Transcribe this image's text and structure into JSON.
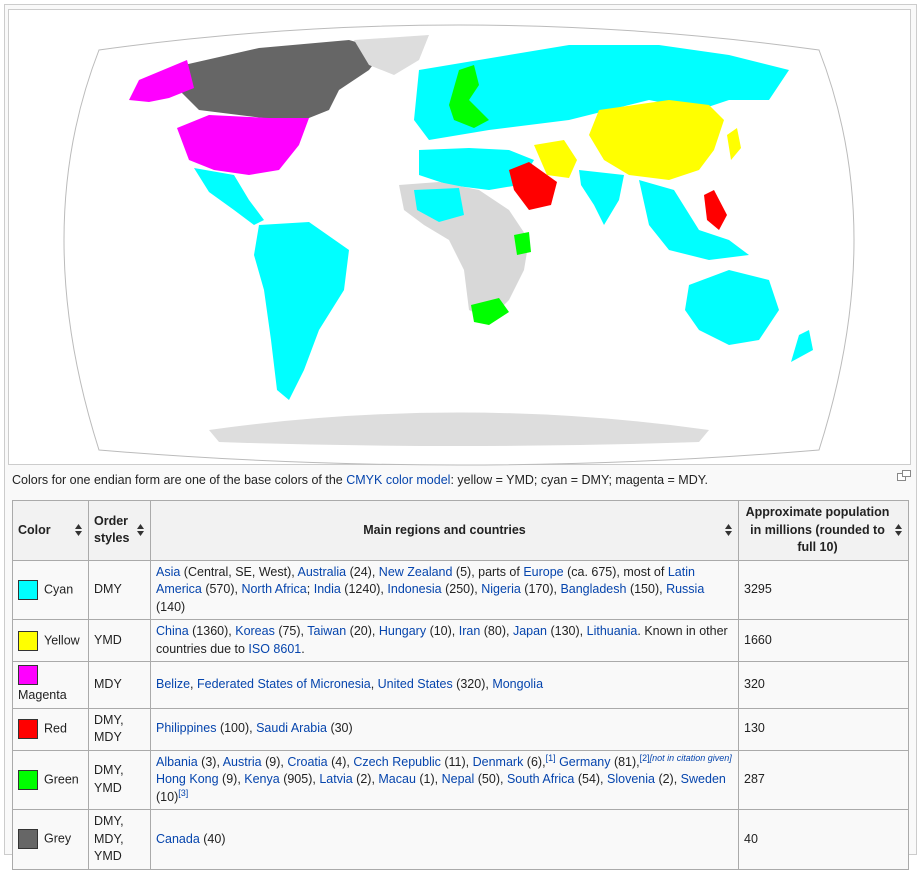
{
  "caption": {
    "before": "Colors for one endian form are one of the base colors of the ",
    "link": "CMYK color model",
    "after": ": yellow = YMD; cyan = DMY; magenta = MDY."
  },
  "map": {
    "colors": {
      "cyan": "#00ffff",
      "yellow": "#ffff00",
      "magenta": "#ff00ff",
      "red": "#ff0000",
      "green": "#00ff00",
      "grey": "#666666",
      "land_unknown": "#d8d8d8",
      "land_light": "#e0e0e0"
    }
  },
  "table": {
    "headers": {
      "color": "Color",
      "order_styles": "Order styles",
      "regions": "Main regions and countries",
      "population": "Approximate population in millions (rounded to full 10)"
    },
    "rows": [
      {
        "swatch": "#00ffff",
        "color": "Cyan",
        "order": "DMY",
        "population": "3295"
      },
      {
        "swatch": "#ffff00",
        "color": "Yellow",
        "order": "YMD",
        "population": "1660"
      },
      {
        "swatch": "#ff00ff",
        "color": "Magenta",
        "order": "MDY",
        "population": "320"
      },
      {
        "swatch": "#ff0000",
        "color": "Red",
        "order": "DMY, MDY",
        "population": "130"
      },
      {
        "swatch": "#00ff00",
        "color": "Green",
        "order": "DMY, YMD",
        "population": "287"
      },
      {
        "swatch": "#666666",
        "color": "Grey",
        "order": "DMY, MDY, YMD",
        "population": "40"
      }
    ],
    "regions": {
      "cyan": {
        "asia": "Asia",
        "asia_note": " (Central, SE, West), ",
        "australia": "Australia",
        "australia_n": " (24), ",
        "nz": "New Zealand",
        "nz_n": " (5), parts of ",
        "europe": "Europe",
        "europe_n": " (ca. 675), most of ",
        "latam": "Latin America",
        "latam_n": " (570), ",
        "nafrica": "North Africa",
        "nafrica_n": "; ",
        "india": "India",
        "india_n": " (1240), ",
        "indonesia": "Indonesia",
        "indonesia_n": " (250), ",
        "nigeria": "Nigeria",
        "nigeria_n": " (170), ",
        "bangladesh": "Bangladesh",
        "bangladesh_n": " (150), ",
        "russia": "Russia",
        "russia_n": " (140)"
      },
      "yellow": {
        "china": "China",
        "china_n": " (1360), ",
        "koreas": "Koreas",
        "koreas_n": " (75), ",
        "taiwan": "Taiwan",
        "taiwan_n": " (20), ",
        "hungary": "Hungary",
        "hungary_n": " (10), ",
        "iran": "Iran",
        "iran_n": " (80), ",
        "japan": "Japan",
        "japan_n": " (130), ",
        "lithuania": "Lithuania",
        "lithuania_n": ". Known in other countries due to ",
        "iso": "ISO 8601",
        "iso_n": "."
      },
      "magenta": {
        "belize": "Belize",
        "sep1": ", ",
        "micronesia": "Federated States of Micronesia",
        "sep2": ", ",
        "usa": "United States",
        "usa_n": " (320), ",
        "mongolia": "Mongolia"
      },
      "red": {
        "philippines": "Philippines",
        "philippines_n": " (100), ",
        "saudi": "Saudi Arabia",
        "saudi_n": " (30)"
      },
      "green": {
        "albania": "Albania",
        "albania_n": " (3), ",
        "austria": "Austria",
        "austria_n": " (9), ",
        "croatia": "Croatia",
        "croatia_n": " (4), ",
        "czech": "Czech Republic",
        "czech_n": " (11), ",
        "denmark": "Denmark",
        "denmark_n": " (6),",
        "ref1": "[1]",
        "germany": "Germany",
        "germany_n": " (81),",
        "ref2": "[2]",
        "note": "[not in citation given]",
        "hongkong": "Hong Kong",
        "hongkong_n": " (9), ",
        "kenya": "Kenya",
        "kenya_n": " (905), ",
        "latvia": "Latvia",
        "latvia_n": " (2), ",
        "macau": "Macau",
        "macau_n": " (1), ",
        "nepal": "Nepal",
        "nepal_n": " (50), ",
        "safrica": "South Africa",
        "safrica_n": " (54), ",
        "slovenia": "Slovenia",
        "slovenia_n": " (2), ",
        "sweden": "Sweden",
        "sweden_n": " (10)",
        "ref3": "[3]"
      },
      "grey": {
        "canada": "Canada",
        "canada_n": " (40)"
      }
    }
  }
}
